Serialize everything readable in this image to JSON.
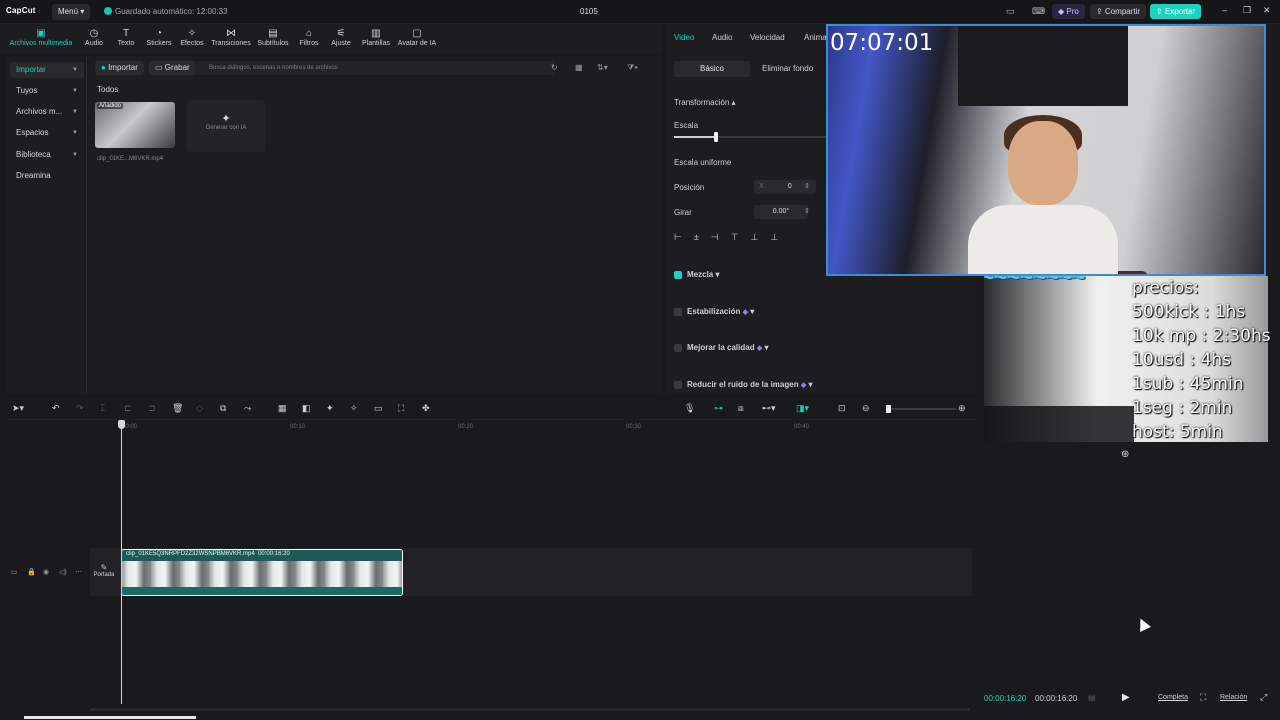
{
  "topbar": {
    "logo": "CapCut",
    "menu": "Menú",
    "autosave": "Guardado automático: 12:00:33",
    "project_title": "0105",
    "pro": "Pro",
    "share": "Compartir",
    "export": "Exportar",
    "accent": "#1dd3c0"
  },
  "media_tabs": [
    {
      "label": "Archivos multimedia",
      "icon": "media-icon"
    },
    {
      "label": "Audio",
      "icon": "audio-icon"
    },
    {
      "label": "Texto",
      "icon": "text-icon"
    },
    {
      "label": "Stickers",
      "icon": "sticker-icon"
    },
    {
      "label": "Efectos",
      "icon": "effects-icon"
    },
    {
      "label": "Transiciones",
      "icon": "transitions-icon"
    },
    {
      "label": "Subtítulos",
      "icon": "subtitles-icon"
    },
    {
      "label": "Filtros",
      "icon": "filters-icon"
    },
    {
      "label": "Ajuste",
      "icon": "adjust-icon"
    },
    {
      "label": "Plantillas",
      "icon": "templates-icon"
    },
    {
      "label": "Avatar de IA",
      "icon": "avatar-icon"
    }
  ],
  "sidebar": {
    "items": [
      {
        "label": "Importar"
      },
      {
        "label": "Tuyos"
      },
      {
        "label": "Archivos m..."
      },
      {
        "label": "Espacios"
      },
      {
        "label": "Biblioteca"
      },
      {
        "label": "Dreamina"
      }
    ]
  },
  "media": {
    "import": "Importar",
    "record": "Grabar",
    "search_placeholder": "Busca diálogos, escenas o nombres de archivos",
    "section": "Todos",
    "thumb_badge": "Añadido",
    "thumb_name": "clip_01KE...M6VKR.mp4",
    "generate": "Generar con IA"
  },
  "props": {
    "tabs": [
      "Video",
      "Audio",
      "Velocidad",
      "Anima"
    ],
    "sub_basic": "Básico",
    "sub_remove_bg": "Eliminar fondo",
    "transform": "Transformación",
    "scale": "Escala",
    "uniform_scale": "Escala uniforme",
    "position": "Posición",
    "pos_x_label": "X",
    "pos_x": "0",
    "rotate": "Girar",
    "rotate_value": "0.00°",
    "blend": "Mezcla",
    "stabilize": "Estabilización",
    "enhance": "Mejorar la calidad",
    "denoise": "Reducir el ruido de la imagen"
  },
  "preview": {
    "clock": "07:07:01",
    "prices": [
      "precios:",
      "500kick : 1hs",
      "10k mp : 2:30hs",
      "10usd : 4hs",
      "1sub : 45min",
      "1seg : 2min",
      "host: 5min"
    ],
    "current_time": "00:00:16:20",
    "total_time": "00:00:16:20",
    "full": "Completa",
    "ratio": "Relación"
  },
  "timeline": {
    "ruler": [
      "00:00",
      "00:10",
      "00:20",
      "00:30",
      "00:40"
    ],
    "cover_label": "Portada",
    "clip_name": "clip_01KE5Q3NRPFD2Z32WSNPBM6VKR.mp4",
    "clip_duration": "00:00:16:20"
  }
}
